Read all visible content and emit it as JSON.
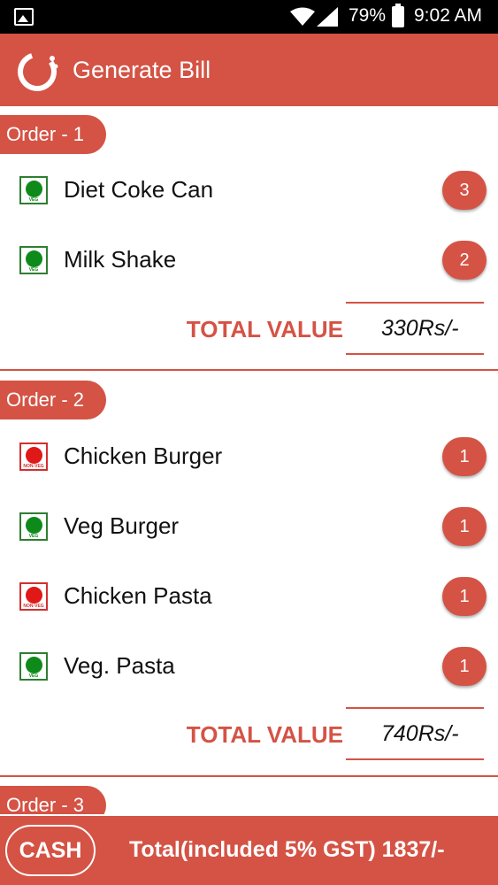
{
  "status_bar": {
    "battery": "79%",
    "time": "9:02 AM"
  },
  "app_bar": {
    "title": "Generate Bill"
  },
  "orders": [
    {
      "label": "Order - 1",
      "items": [
        {
          "name": "Diet Coke Can",
          "type": "VEG",
          "qty": "3"
        },
        {
          "name": "Milk Shake",
          "type": "VEG",
          "qty": "2"
        }
      ],
      "total_label": "TOTAL VALUE",
      "total_value": "330Rs/-"
    },
    {
      "label": "Order - 2",
      "items": [
        {
          "name": "Chicken Burger",
          "type": "NON-VEG",
          "qty": "1"
        },
        {
          "name": "Veg Burger",
          "type": "VEG",
          "qty": "1"
        },
        {
          "name": "Chicken Pasta",
          "type": "NON-VEG",
          "qty": "1"
        },
        {
          "name": "Veg. Pasta",
          "type": "VEG",
          "qty": "1"
        }
      ],
      "total_label": "TOTAL VALUE",
      "total_value": "740Rs/-"
    },
    {
      "label": "Order - 3"
    }
  ],
  "bottom_bar": {
    "cash_label": "CASH",
    "grand_total": "Total(included 5% GST) 1837/-"
  },
  "colors": {
    "accent": "#d45345",
    "veg": "#0e8a1a",
    "nonveg": "#e01818"
  }
}
